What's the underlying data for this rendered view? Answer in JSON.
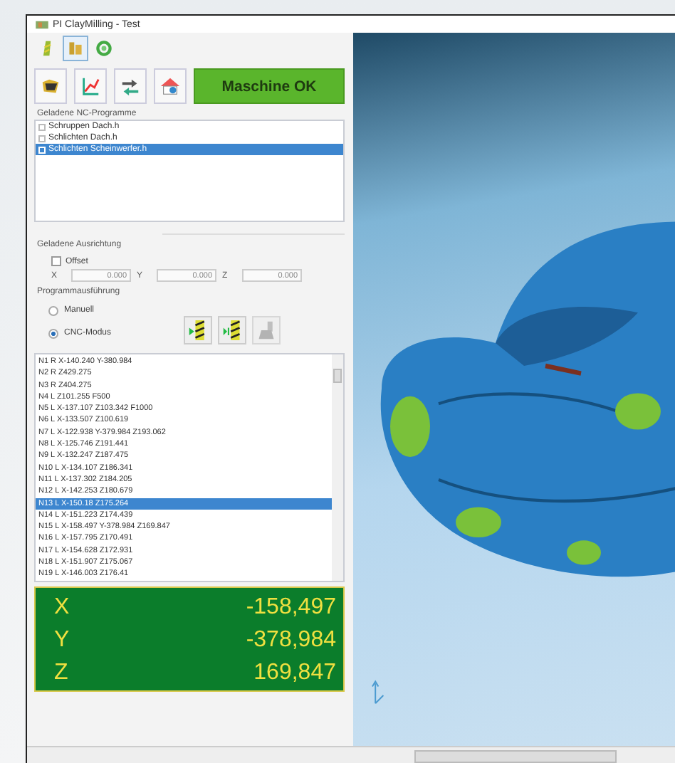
{
  "window": {
    "title": "PI ClayMilling - Test"
  },
  "mode_tabs": [
    {
      "selected": false
    },
    {
      "selected": true
    },
    {
      "selected": false
    }
  ],
  "status_button": {
    "label": "Maschine OK"
  },
  "nc_programs": {
    "title": "Geladene NC-Programme",
    "items": [
      {
        "name": "Schruppen Dach.h",
        "checked": false,
        "selected": false
      },
      {
        "name": "Schlichten Dach.h",
        "checked": false,
        "selected": false
      },
      {
        "name": "Schlichten Scheinwerfer.h",
        "checked": true,
        "selected": true
      }
    ]
  },
  "alignment": {
    "title": "Geladene Ausrichtung",
    "offset": {
      "label": "Offset",
      "checked": false
    },
    "fields": [
      {
        "axis": "X",
        "value": "0.000"
      },
      {
        "axis": "Y",
        "value": "0.000"
      },
      {
        "axis": "Z",
        "value": "0.000"
      }
    ]
  },
  "execution": {
    "title": "Programmausführung",
    "modes": [
      {
        "label": "Manuell",
        "selected": false
      },
      {
        "label": "CNC-Modus",
        "selected": true
      }
    ]
  },
  "nc_code": {
    "lines": [
      {
        "text": "N1 R X-140.240 Y-380.984",
        "selected": false
      },
      {
        "text": "N2 R Z429.275",
        "selected": false
      },
      {
        "text": "N3 R Z404.275",
        "selected": false
      },
      {
        "text": "N4 L Z101.255 F500",
        "selected": false
      },
      {
        "text": "N5 L X-137.107 Z103.342 F1000",
        "selected": false
      },
      {
        "text": "N6 L X-133.507 Z100.619",
        "selected": false
      },
      {
        "text": "N7 L X-122.938 Y-379.984 Z193.062",
        "selected": false
      },
      {
        "text": "N8 L X-125.746 Z191.441",
        "selected": false
      },
      {
        "text": "N9 L X-132.247 Z187.475",
        "selected": false
      },
      {
        "text": "N10 L X-134.107 Z186.341",
        "selected": false
      },
      {
        "text": "N11 L X-137.302 Z184.205",
        "selected": false
      },
      {
        "text": "N12 L X-142.253 Z180.679",
        "selected": false
      },
      {
        "text": "N13 L X-150.18 Z175.264",
        "selected": true
      },
      {
        "text": "N14 L X-151.223 Z174.439",
        "selected": false
      },
      {
        "text": "N15 L X-158.497 Y-378.984 Z169.847",
        "selected": false
      },
      {
        "text": "N16 L X-157.795 Z170.491",
        "selected": false
      },
      {
        "text": "N17 L X-154.628 Z172.931",
        "selected": false
      },
      {
        "text": "N18 L X-151.907 Z175.067",
        "selected": false
      },
      {
        "text": "N19 L X-146.003 Z176.41",
        "selected": false
      }
    ]
  },
  "position": [
    {
      "axis": "X",
      "value": "-158,497"
    },
    {
      "axis": "Y",
      "value": "-378,984"
    },
    {
      "axis": "Z",
      "value": "169,847"
    }
  ]
}
